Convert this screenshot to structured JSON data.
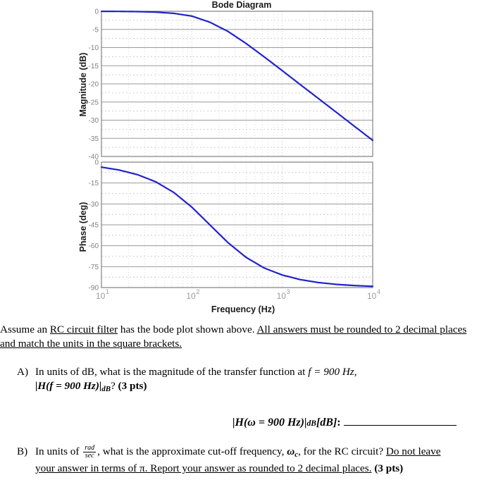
{
  "chart_data": {
    "type": "line",
    "title": "Bode Diagram",
    "xlabel": "Frequency  (Hz)",
    "xscale": "log",
    "xlim": [
      10,
      10000
    ],
    "xticks": [
      10,
      100,
      1000,
      10000
    ],
    "xtick_labels": [
      "10¹",
      "10²",
      "10³",
      "10⁴"
    ],
    "xtick_bases": [
      "10",
      "10",
      "10",
      "10"
    ],
    "xtick_exponents": [
      "1",
      "2",
      "3",
      "4"
    ],
    "grid": true,
    "legend": "none",
    "curve_color": "#2222cc",
    "filter_type": "RC low-pass (first order)",
    "corner_frequency_hz": 158,
    "subplots": [
      {
        "name": "magnitude",
        "ylabel": "Magnitude (dB)",
        "ylim": [
          -40,
          0
        ],
        "yticks": [
          0,
          -5,
          -10,
          -15,
          -20,
          -25,
          -30,
          -35,
          -40
        ],
        "ytick_labels": [
          "0",
          "-5",
          "-10",
          "-15",
          "-20",
          "-25",
          "-30",
          "-35",
          "-40"
        ],
        "x": [
          10,
          15.8,
          25.1,
          39.8,
          63.1,
          100,
          158,
          251,
          398,
          631,
          1000,
          1580,
          2510,
          3980,
          6310,
          10000
        ],
        "y": [
          -0.015,
          -0.037,
          -0.093,
          -0.23,
          -0.57,
          -1.33,
          -3.01,
          -5.55,
          -8.87,
          -12.56,
          -16.36,
          -20.19,
          -24.03,
          -27.87,
          -31.72,
          -35.56
        ]
      },
      {
        "name": "phase",
        "ylabel": "Phase (deg)",
        "ylim": [
          -90,
          0
        ],
        "yticks": [
          0,
          -15,
          -30,
          -45,
          -60,
          -75,
          -90
        ],
        "ytick_labels": [
          "0",
          "-15",
          "-30",
          "-45",
          "-60",
          "-75",
          "-90"
        ],
        "x": [
          10,
          15.8,
          25.1,
          39.8,
          63.1,
          100,
          158,
          251,
          398,
          631,
          1000,
          1580,
          2510,
          3980,
          6310,
          10000
        ],
        "y": [
          -3.62,
          -5.71,
          -9.02,
          -14.12,
          -21.77,
          -32.33,
          -45.0,
          -57.78,
          -68.35,
          -75.98,
          -81.0,
          -84.29,
          -86.4,
          -87.73,
          -88.57,
          -89.1
        ]
      }
    ]
  },
  "prose": {
    "intro_a": "Assume an ",
    "intro_rc": "RC circuit filter",
    "intro_b": " has the bode plot shown above. ",
    "intro_underlined": "All answers must be rounded to 2 decimal places and match the units in the square brackets.",
    "question_a": {
      "letter": "A)",
      "line1_before": "In units of dB, what is the magnitude of the transfer function at ",
      "line1_math": "f = 900 Hz",
      "line1_after": ",",
      "line2_math_1": "|H(f = 900 Hz)|",
      "line2_sub": "dB",
      "line2_after": "? ",
      "line2_points": "(3 pts)"
    },
    "answer_prompt": {
      "math_1": "|H(ω = 900 Hz)|",
      "sub": "dB",
      "units": " [dB]",
      "colon": " :"
    },
    "question_b": {
      "letter": "B)",
      "line1_before": "In units of ",
      "frac_num": "rad",
      "frac_den": "sec",
      "line1_mid": ", what is the approximate cut-off frequency, ",
      "omega": "ω",
      "omega_sub": "c",
      "line1_after": ", for the RC circuit? ",
      "line1_underlined": "Do not leave",
      "line2_underlined": "your answer in terms of π. Report your answer as rounded to 2 decimal places.",
      "line2_points": " (3 pts)"
    }
  }
}
